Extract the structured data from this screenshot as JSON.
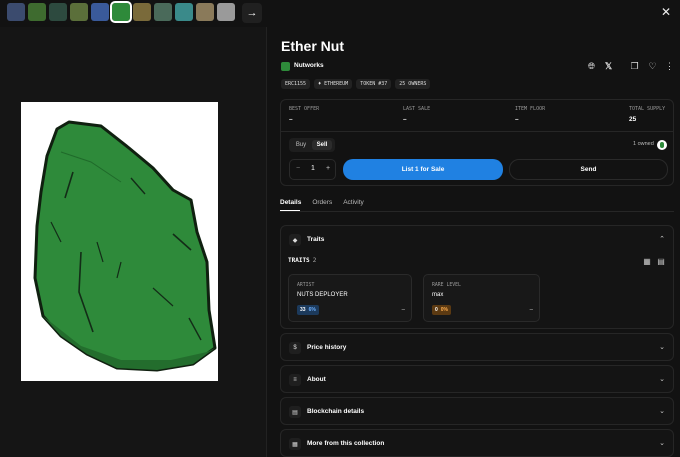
{
  "topbar": {
    "thumbnails": [
      "#3b4b6e",
      "#3e6b2f",
      "#2d4a3f",
      "#5b6f3a",
      "#3a5a9a",
      "#2e8a3a",
      "#7a6a3a",
      "#4a6a5a",
      "#3a8a8a",
      "#8a7a5a",
      "#9a9a9a"
    ],
    "next_icon": "arrow-right-icon",
    "close_icon": "close-icon"
  },
  "item": {
    "title": "Ether Nut",
    "collection": "Nutworks",
    "chips": [
      "ERC1155",
      "♦ ETHEREUM",
      "TOKEN #37",
      "25 OWNERS"
    ]
  },
  "stats": {
    "best_offer": {
      "label": "BEST OFFER",
      "value": "–"
    },
    "last_sale": {
      "label": "LAST SALE",
      "value": "–"
    },
    "item_floor": {
      "label": "ITEM FLOOR",
      "value": "–"
    },
    "total_supply": {
      "label": "TOTAL SUPPLY",
      "value": "25"
    }
  },
  "trade": {
    "buy": "Buy",
    "sell": "Sell",
    "owned": "1 owned",
    "minus": "−",
    "quantity": "1",
    "plus": "+",
    "list_button": "List 1 for Sale",
    "send_button": "Send"
  },
  "tabs": [
    "Details",
    "Orders",
    "Activity"
  ],
  "traits": {
    "title": "Traits",
    "label": "TRAITS",
    "count": "2",
    "cards": [
      {
        "type": "ARTIST",
        "value": "NUTS DEPLOYER",
        "count": "33",
        "pct": "6%",
        "price": "–",
        "badge_bg": "#1c3a5c",
        "badge_fg": "#6fb1ff"
      },
      {
        "type": "RARE LEVEL",
        "value": "max",
        "count": "0",
        "pct": "0%",
        "price": "–",
        "badge_bg": "#5c3a12",
        "badge_fg": "#ffae4f"
      }
    ]
  },
  "sections": {
    "price_history": "Price history",
    "about": "About",
    "blockchain": "Blockchain details",
    "more": "More from this collection"
  }
}
